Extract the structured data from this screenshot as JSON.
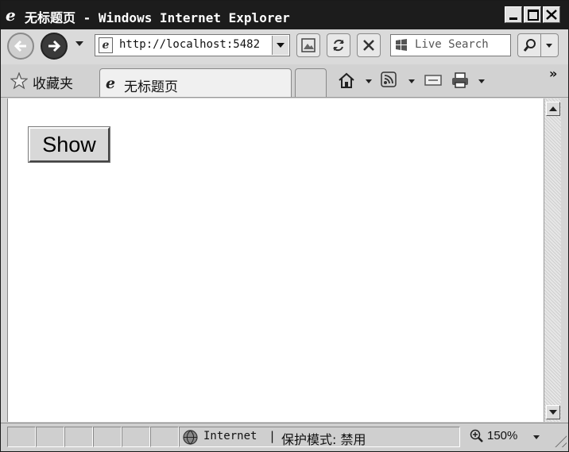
{
  "window": {
    "title": "无标题页 - Windows Internet Explorer",
    "buttons": {
      "minimize": "minimize",
      "maximize": "maximize",
      "close": "close"
    }
  },
  "nav": {
    "address": "http://localhost:5482",
    "search_placeholder": "Live Search"
  },
  "favorites": {
    "label": "收藏夹"
  },
  "tabs": [
    {
      "label": "无标题页"
    }
  ],
  "toolbar": {
    "overflow": "»"
  },
  "page": {
    "show_button": "Show"
  },
  "status": {
    "zone": "Internet",
    "separator": "|",
    "protected_mode": "保护模式: 禁用",
    "zoom": "150%"
  },
  "icons": {
    "ie_logo": "ie-icon",
    "back": "back-arrow-icon",
    "forward": "forward-arrow-icon",
    "compat": "compatibility-view-icon",
    "refresh": "refresh-icon",
    "stop": "stop-icon",
    "search": "search-icon",
    "star": "star-icon",
    "home": "home-icon",
    "feeds": "rss-icon",
    "mail": "mail-icon",
    "print": "print-icon",
    "globe": "globe-icon",
    "zoom": "zoom-icon"
  }
}
